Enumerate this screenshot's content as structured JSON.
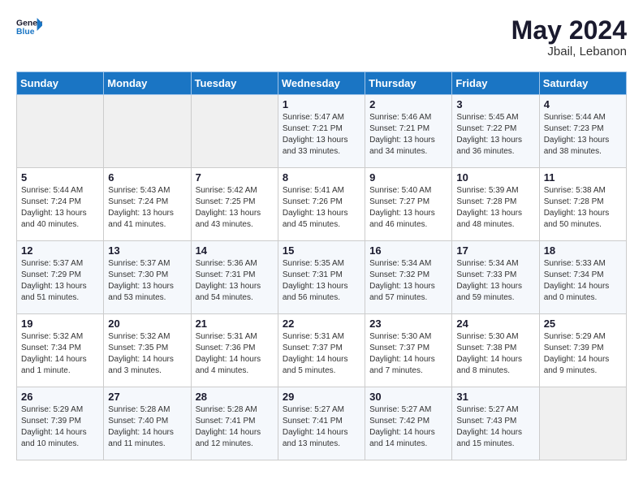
{
  "header": {
    "logo_line1": "General",
    "logo_line2": "Blue",
    "month_year": "May 2024",
    "location": "Jbail, Lebanon"
  },
  "days_of_week": [
    "Sunday",
    "Monday",
    "Tuesday",
    "Wednesday",
    "Thursday",
    "Friday",
    "Saturday"
  ],
  "weeks": [
    [
      {
        "day": "",
        "info": ""
      },
      {
        "day": "",
        "info": ""
      },
      {
        "day": "",
        "info": ""
      },
      {
        "day": "1",
        "info": "Sunrise: 5:47 AM\nSunset: 7:21 PM\nDaylight: 13 hours\nand 33 minutes."
      },
      {
        "day": "2",
        "info": "Sunrise: 5:46 AM\nSunset: 7:21 PM\nDaylight: 13 hours\nand 34 minutes."
      },
      {
        "day": "3",
        "info": "Sunrise: 5:45 AM\nSunset: 7:22 PM\nDaylight: 13 hours\nand 36 minutes."
      },
      {
        "day": "4",
        "info": "Sunrise: 5:44 AM\nSunset: 7:23 PM\nDaylight: 13 hours\nand 38 minutes."
      }
    ],
    [
      {
        "day": "5",
        "info": "Sunrise: 5:44 AM\nSunset: 7:24 PM\nDaylight: 13 hours\nand 40 minutes."
      },
      {
        "day": "6",
        "info": "Sunrise: 5:43 AM\nSunset: 7:24 PM\nDaylight: 13 hours\nand 41 minutes."
      },
      {
        "day": "7",
        "info": "Sunrise: 5:42 AM\nSunset: 7:25 PM\nDaylight: 13 hours\nand 43 minutes."
      },
      {
        "day": "8",
        "info": "Sunrise: 5:41 AM\nSunset: 7:26 PM\nDaylight: 13 hours\nand 45 minutes."
      },
      {
        "day": "9",
        "info": "Sunrise: 5:40 AM\nSunset: 7:27 PM\nDaylight: 13 hours\nand 46 minutes."
      },
      {
        "day": "10",
        "info": "Sunrise: 5:39 AM\nSunset: 7:28 PM\nDaylight: 13 hours\nand 48 minutes."
      },
      {
        "day": "11",
        "info": "Sunrise: 5:38 AM\nSunset: 7:28 PM\nDaylight: 13 hours\nand 50 minutes."
      }
    ],
    [
      {
        "day": "12",
        "info": "Sunrise: 5:37 AM\nSunset: 7:29 PM\nDaylight: 13 hours\nand 51 minutes."
      },
      {
        "day": "13",
        "info": "Sunrise: 5:37 AM\nSunset: 7:30 PM\nDaylight: 13 hours\nand 53 minutes."
      },
      {
        "day": "14",
        "info": "Sunrise: 5:36 AM\nSunset: 7:31 PM\nDaylight: 13 hours\nand 54 minutes."
      },
      {
        "day": "15",
        "info": "Sunrise: 5:35 AM\nSunset: 7:31 PM\nDaylight: 13 hours\nand 56 minutes."
      },
      {
        "day": "16",
        "info": "Sunrise: 5:34 AM\nSunset: 7:32 PM\nDaylight: 13 hours\nand 57 minutes."
      },
      {
        "day": "17",
        "info": "Sunrise: 5:34 AM\nSunset: 7:33 PM\nDaylight: 13 hours\nand 59 minutes."
      },
      {
        "day": "18",
        "info": "Sunrise: 5:33 AM\nSunset: 7:34 PM\nDaylight: 14 hours\nand 0 minutes."
      }
    ],
    [
      {
        "day": "19",
        "info": "Sunrise: 5:32 AM\nSunset: 7:34 PM\nDaylight: 14 hours\nand 1 minute."
      },
      {
        "day": "20",
        "info": "Sunrise: 5:32 AM\nSunset: 7:35 PM\nDaylight: 14 hours\nand 3 minutes."
      },
      {
        "day": "21",
        "info": "Sunrise: 5:31 AM\nSunset: 7:36 PM\nDaylight: 14 hours\nand 4 minutes."
      },
      {
        "day": "22",
        "info": "Sunrise: 5:31 AM\nSunset: 7:37 PM\nDaylight: 14 hours\nand 5 minutes."
      },
      {
        "day": "23",
        "info": "Sunrise: 5:30 AM\nSunset: 7:37 PM\nDaylight: 14 hours\nand 7 minutes."
      },
      {
        "day": "24",
        "info": "Sunrise: 5:30 AM\nSunset: 7:38 PM\nDaylight: 14 hours\nand 8 minutes."
      },
      {
        "day": "25",
        "info": "Sunrise: 5:29 AM\nSunset: 7:39 PM\nDaylight: 14 hours\nand 9 minutes."
      }
    ],
    [
      {
        "day": "26",
        "info": "Sunrise: 5:29 AM\nSunset: 7:39 PM\nDaylight: 14 hours\nand 10 minutes."
      },
      {
        "day": "27",
        "info": "Sunrise: 5:28 AM\nSunset: 7:40 PM\nDaylight: 14 hours\nand 11 minutes."
      },
      {
        "day": "28",
        "info": "Sunrise: 5:28 AM\nSunset: 7:41 PM\nDaylight: 14 hours\nand 12 minutes."
      },
      {
        "day": "29",
        "info": "Sunrise: 5:27 AM\nSunset: 7:41 PM\nDaylight: 14 hours\nand 13 minutes."
      },
      {
        "day": "30",
        "info": "Sunrise: 5:27 AM\nSunset: 7:42 PM\nDaylight: 14 hours\nand 14 minutes."
      },
      {
        "day": "31",
        "info": "Sunrise: 5:27 AM\nSunset: 7:43 PM\nDaylight: 14 hours\nand 15 minutes."
      },
      {
        "day": "",
        "info": ""
      }
    ]
  ]
}
